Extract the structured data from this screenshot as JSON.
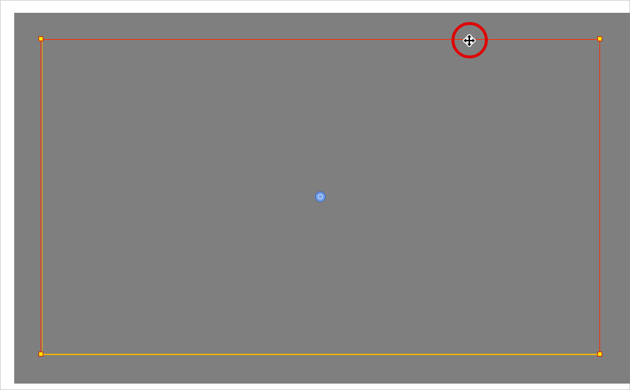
{
  "canvas": {
    "background_color": "#7f7f7f"
  },
  "selection": {
    "border_color": "#ff2a00",
    "handle_color": "#ffe600",
    "handles": [
      "top-left",
      "top-right",
      "bottom-left",
      "bottom-right"
    ]
  },
  "pivot": {
    "color": "#6f9ce6"
  },
  "annotation": {
    "ring_color": "#e00000"
  },
  "cursor": {
    "icon": "move-cursor-icon"
  }
}
